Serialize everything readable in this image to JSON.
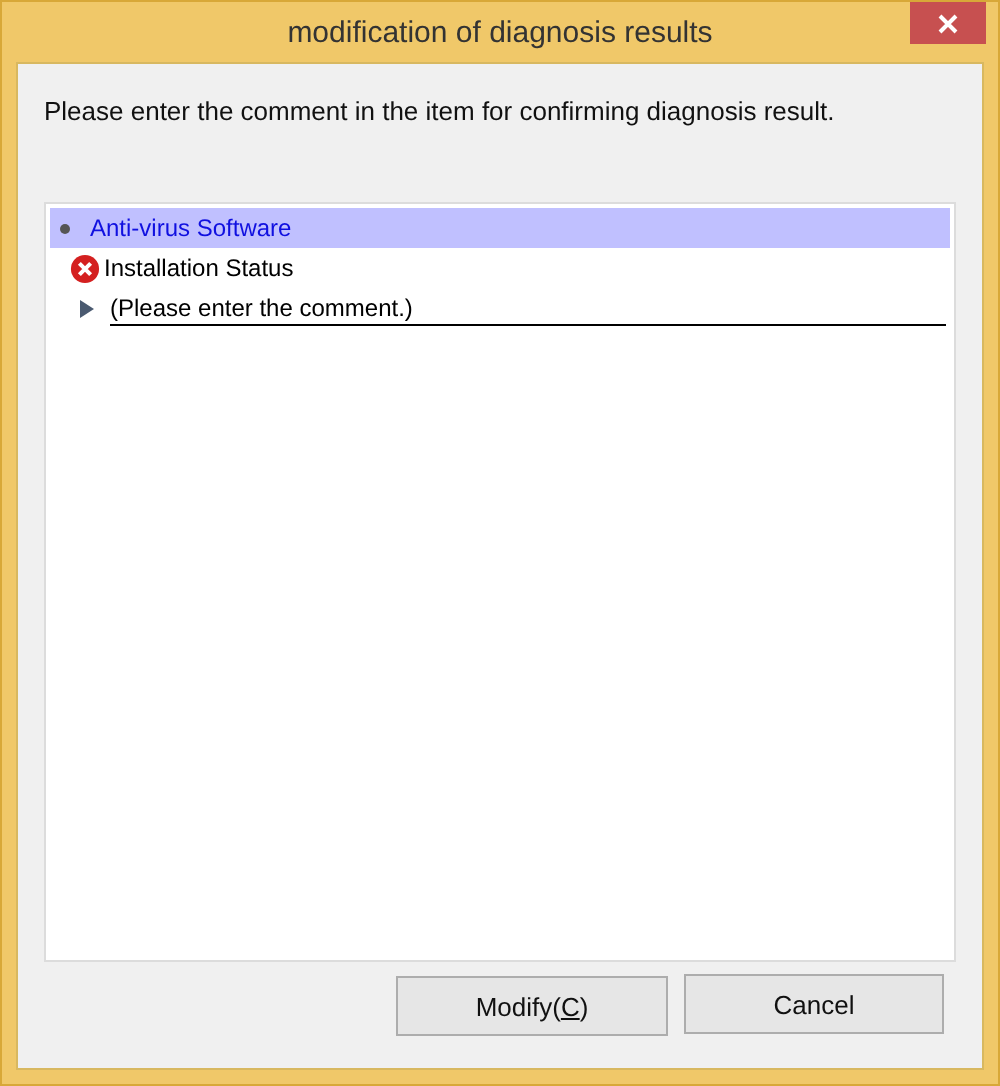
{
  "window": {
    "title": "modification of diagnosis results"
  },
  "instruction": "Please enter the comment in the item for confirming diagnosis result.",
  "tree": [
    {
      "label": "Anti-virus Software",
      "selected": true,
      "children": [
        {
          "label": "Installation Status",
          "failed": true,
          "children": [
            {
              "kind": "comment",
              "placeholder": "(Please enter the comment.)"
            }
          ]
        }
      ]
    }
  ],
  "buttons": [
    {
      "before": "Modify(",
      "mnemonic": "C",
      "after": ")"
    },
    {
      "before": "Cancel"
    }
  ]
}
